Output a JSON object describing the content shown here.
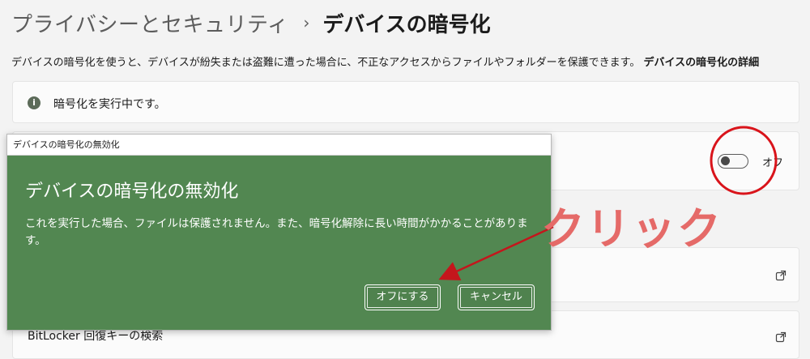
{
  "header": {
    "parent": "プライバシーとセキュリティ",
    "separator": "›",
    "current": "デバイスの暗号化"
  },
  "description": {
    "text": "デバイスの暗号化を使うと、デバイスが紛失または盗難に遭った場合に、不正なアクセスからファイルやフォルダーを保護できます。",
    "link": "デバイスの暗号化の詳細"
  },
  "info_card": {
    "icon": "info-icon",
    "icon_glyph": "i",
    "text": "暗号化を実行中です。"
  },
  "toggle": {
    "state_label": "オフ",
    "is_on": false
  },
  "bitlocker": {
    "label": "BitLocker 回復キーの検索"
  },
  "dialog": {
    "titlebar": "デバイスの暗号化の無効化",
    "heading": "デバイスの暗号化の無効化",
    "message": "これを実行した場合、ファイルは保護されません。また、暗号化解除に長い時間がかかることがあります。",
    "confirm_button": "オフにする",
    "cancel_button": "キャンセル",
    "background_color": "#528751"
  },
  "annotation": {
    "label": "クリック",
    "color": "#e56a68",
    "circle_color": "#d9141b",
    "arrow_color": "#c4161c"
  }
}
